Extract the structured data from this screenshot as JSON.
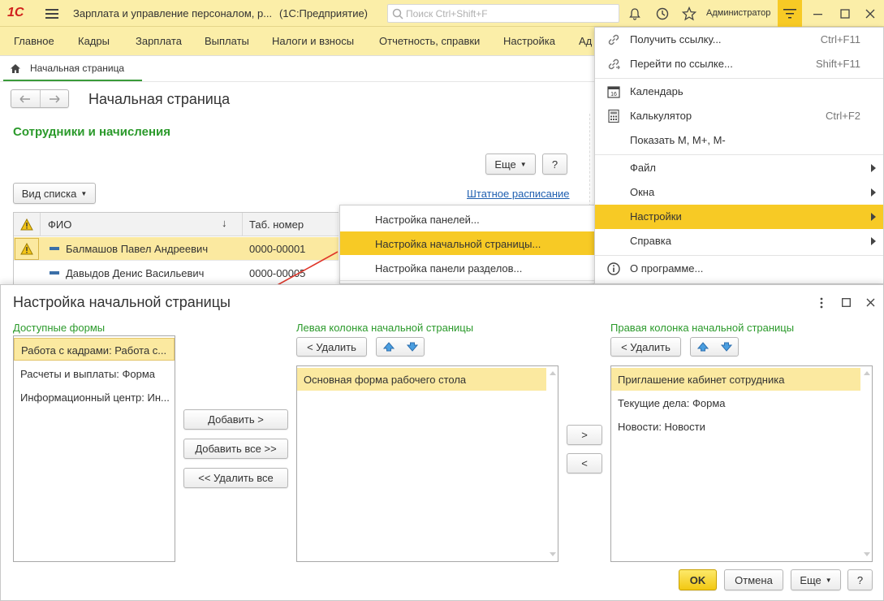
{
  "app": {
    "logo": "1С",
    "title": "Зарплата и управление персоналом, р...",
    "platform": "(1С:Предприятие)",
    "search_placeholder": "Поиск Ctrl+Shift+F",
    "user": "Администратор"
  },
  "sections": [
    "Главное",
    "Кадры",
    "Зарплата",
    "Выплаты",
    "Налоги и взносы",
    "Отчетность, справки",
    "Настройка",
    "Ад"
  ],
  "home_tab": "Начальная страница",
  "page": {
    "title": "Начальная страница",
    "section_title": "Сотрудники и начисления",
    "more_button": "Еще",
    "help_button": "?",
    "view_button": "Вид списка",
    "staff_link": "Штатное расписание",
    "table_headers": {
      "fio": "ФИО",
      "tab_number": "Таб. номер"
    },
    "rows": [
      {
        "fio": "Балмашов Павел Андреевич",
        "tab_number": "0000-00001",
        "warning": true
      },
      {
        "fio": "Давыдов Денис Васильевич",
        "tab_number": "0000-00005",
        "warning": false
      }
    ]
  },
  "popup_menu": [
    "Настройка панелей...",
    "Настройка начальной страницы...",
    "Настройка панели разделов..."
  ],
  "main_menu": {
    "items": [
      {
        "label": "Получить ссылку...",
        "shortcut": "Ctrl+F11",
        "icon": "link-icon"
      },
      {
        "label": "Перейти по ссылке...",
        "shortcut": "Shift+F11",
        "icon": "goto-link-icon"
      },
      {
        "label": "Календарь",
        "shortcut": "",
        "icon": "calendar-icon"
      },
      {
        "label": "Калькулятор",
        "shortcut": "Ctrl+F2",
        "icon": "calculator-icon"
      },
      {
        "label": "Показать М, М+, М-",
        "shortcut": "",
        "icon": ""
      },
      {
        "label": "Файл",
        "submenu": true
      },
      {
        "label": "Окна",
        "submenu": true
      },
      {
        "label": "Настройки",
        "submenu": true,
        "highlighted": true
      },
      {
        "label": "Справка",
        "submenu": true
      },
      {
        "label": "О программе...",
        "icon": "info-icon"
      }
    ]
  },
  "dialog": {
    "title": "Настройка начальной страницы",
    "available_label": "Доступные формы",
    "available_items": [
      "Работа с кадрами: Работа с...",
      "Расчеты и выплаты: Форма",
      "Информационный центр: Ин..."
    ],
    "add_button": "Добавить >",
    "add_all_button": "Добавить все >>",
    "remove_all_button": "<< Удалить все",
    "left_label": "Левая колонка начальной страницы",
    "left_remove": "< Удалить",
    "left_items": [
      "Основная форма рабочего стола"
    ],
    "move_right": ">",
    "move_left": "<",
    "right_label": "Правая колонка начальной страницы",
    "right_remove": "< Удалить",
    "right_items": [
      "Приглашение кабинет сотрудника",
      "Текущие дела: Форма",
      "Новости: Новости"
    ],
    "ok": "OK",
    "cancel": "Отмена",
    "more": "Еще",
    "help": "?"
  },
  "colors": {
    "accent_yellow": "#fbeea8",
    "highlight": "#f7ca25",
    "green_label": "#2b9a2b",
    "arrow_red": "#e0362a"
  }
}
